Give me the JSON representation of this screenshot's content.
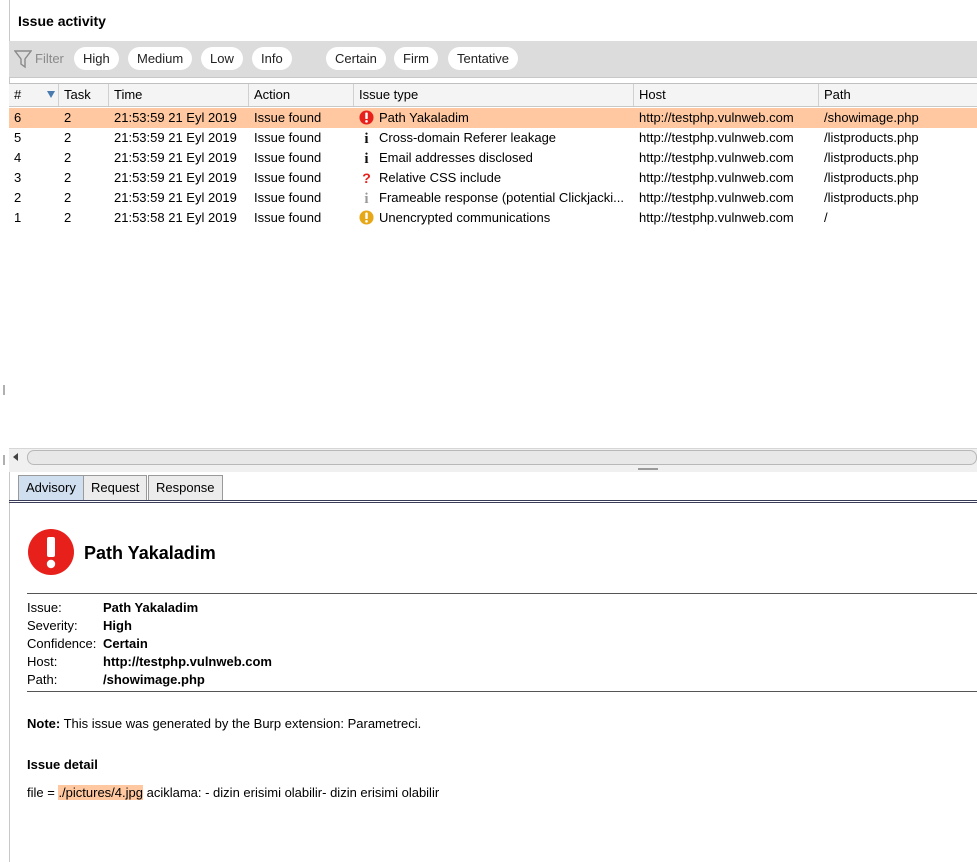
{
  "header": {
    "title": "Issue activity"
  },
  "filter": {
    "label": "Filter",
    "severity": [
      "High",
      "Medium",
      "Low",
      "Info"
    ],
    "confidence": [
      "Certain",
      "Firm",
      "Tentative"
    ]
  },
  "table": {
    "columns": [
      "#",
      "Task",
      "Time",
      "Action",
      "Issue type",
      "Host",
      "Path"
    ],
    "rows": [
      {
        "num": "6",
        "task": "2",
        "time": "21:53:59 21 Eyl 2019",
        "action": "Issue found",
        "issue": "Path Yakaladim",
        "icon": "high-severity-icon",
        "host": "http://testphp.vulnweb.com",
        "path": "/showimage.php",
        "selected": true
      },
      {
        "num": "5",
        "task": "2",
        "time": "21:53:59 21 Eyl 2019",
        "action": "Issue found",
        "issue": "Cross-domain Referer leakage",
        "icon": "info-icon",
        "host": "http://testphp.vulnweb.com",
        "path": "/listproducts.php"
      },
      {
        "num": "4",
        "task": "2",
        "time": "21:53:59 21 Eyl 2019",
        "action": "Issue found",
        "issue": "Email addresses disclosed",
        "icon": "info-icon",
        "host": "http://testphp.vulnweb.com",
        "path": "/listproducts.php"
      },
      {
        "num": "3",
        "task": "2",
        "time": "21:53:59 21 Eyl 2019",
        "action": "Issue found",
        "issue": "Relative CSS include",
        "icon": "question-icon",
        "host": "http://testphp.vulnweb.com",
        "path": "/listproducts.php"
      },
      {
        "num": "2",
        "task": "2",
        "time": "21:53:59 21 Eyl 2019",
        "action": "Issue found",
        "issue": "Frameable response (potential Clickjacki...",
        "icon": "info-tentative-icon",
        "host": "http://testphp.vulnweb.com",
        "path": "/listproducts.php"
      },
      {
        "num": "1",
        "task": "2",
        "time": "21:53:58 21 Eyl 2019",
        "action": "Issue found",
        "issue": "Unencrypted communications",
        "icon": "low-severity-icon",
        "host": "http://testphp.vulnweb.com",
        "path": "/"
      }
    ]
  },
  "tabs": [
    "Advisory",
    "Request",
    "Response"
  ],
  "advisory": {
    "title": "Path Yakaladim",
    "fields": [
      {
        "key": "Issue:",
        "value": "Path Yakaladim"
      },
      {
        "key": "Severity:",
        "value": "High"
      },
      {
        "key": "Confidence:",
        "value": "Certain"
      },
      {
        "key": "Host:",
        "value": "http://testphp.vulnweb.com"
      },
      {
        "key": "Path:",
        "value": "/showimage.php"
      }
    ],
    "note_label": "Note:",
    "note_text": " This issue was generated by the Burp extension: Parametreci.",
    "detail_heading": "Issue detail",
    "detail_prefix": "file = ",
    "detail_highlight": "./pictures/4.jpg",
    "detail_suffix": " aciklama: - dizin erisimi olabilir- dizin erisimi olabilir"
  },
  "colors": {
    "selected_row": "#ffc8a0",
    "high": "#e8201c",
    "low": "#e6a817",
    "active_tab": "#cfdff0"
  }
}
